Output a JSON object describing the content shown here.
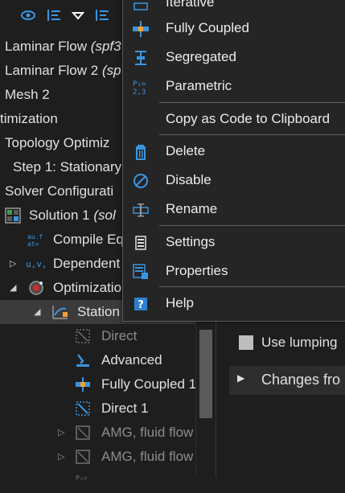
{
  "colors": {
    "background": "#1e1e1e",
    "menu_bg": "#252526",
    "accent_blue": "#3a95e0",
    "accent_orange": "#f0a030",
    "selected_row": "#3b3b3b"
  },
  "toolbar": {
    "icons": [
      "eye-icon",
      "sort-ascending-icon",
      "chevron-down-icon",
      "sort-descending-icon"
    ]
  },
  "tree": {
    "items": [
      {
        "label": "Laminar Flow",
        "suffix": "(spf3",
        "icon": ""
      },
      {
        "label": "Laminar Flow 2",
        "suffix": "(sp",
        "icon": ""
      },
      {
        "label": "Mesh 2",
        "suffix": "",
        "icon": ""
      },
      {
        "label": "timization",
        "suffix": "",
        "icon": ""
      },
      {
        "label": "Topology Optimiz",
        "suffix": "",
        "icon": ""
      },
      {
        "label": "Step 1: Stationary",
        "suffix": "",
        "icon": ""
      },
      {
        "label": "Solver Configurati",
        "suffix": "",
        "icon": ""
      },
      {
        "label": "Solution 1",
        "suffix": "(sol",
        "icon": "solution-icon"
      },
      {
        "label": "Compile Eq",
        "suffix": "",
        "icon": "compile-equations-icon"
      },
      {
        "label": "Dependent",
        "suffix": "",
        "icon": "dependent-variables-icon"
      },
      {
        "label": "Optimization",
        "suffix": "",
        "icon": "optimization-solver-icon"
      },
      {
        "label": "Station",
        "suffix": "",
        "icon": "stationary-solver-icon"
      },
      {
        "label": "Direct",
        "suffix": "",
        "icon": "direct-icon"
      },
      {
        "label": "Advanced",
        "suffix": "",
        "icon": "advanced-icon"
      },
      {
        "label": "Fully Coupled 1",
        "suffix": "",
        "icon": "fully-coupled-icon"
      },
      {
        "label": "Direct 1",
        "suffix": "",
        "icon": "direct-icon"
      },
      {
        "label": "AMG, fluid flow",
        "suffix": "",
        "icon": "amg-icon"
      },
      {
        "label": "AMG, fluid flow",
        "suffix": "",
        "icon": "amg-icon"
      }
    ]
  },
  "settings_pane": {
    "use_lumping": "Use lumping",
    "changes_from": "Changes fro"
  },
  "context_menu": {
    "items": [
      {
        "label": "Iterative",
        "icon": "iterative-icon"
      },
      {
        "label": "Fully Coupled",
        "icon": "fully-coupled-icon"
      },
      {
        "label": "Segregated",
        "icon": "segregated-icon"
      },
      {
        "label": "Parametric",
        "icon": "parametric-icon"
      },
      {
        "label": "Copy as Code to Clipboard",
        "icon": ""
      },
      {
        "label": "Delete",
        "icon": "delete-icon"
      },
      {
        "label": "Disable",
        "icon": "disable-icon"
      },
      {
        "label": "Rename",
        "icon": "rename-icon"
      },
      {
        "label": "Settings",
        "icon": "settings-icon"
      },
      {
        "label": "Properties",
        "icon": "properties-icon"
      },
      {
        "label": "Help",
        "icon": "help-icon"
      }
    ]
  }
}
